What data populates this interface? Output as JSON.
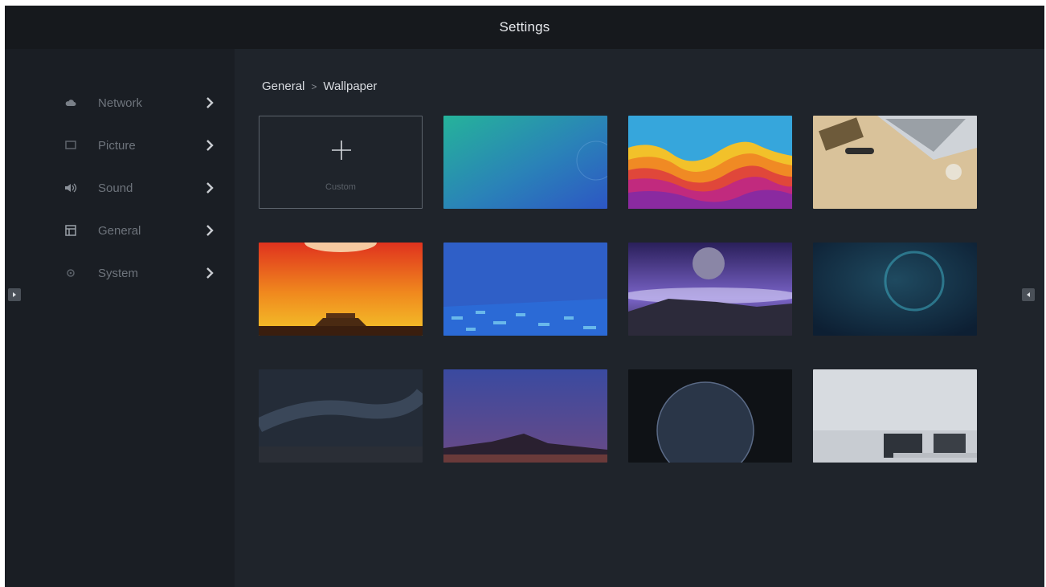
{
  "window": {
    "title": "Settings"
  },
  "sidebar": {
    "items": [
      {
        "label": "Network",
        "icon": "cloud-icon"
      },
      {
        "label": "Picture",
        "icon": "picture-icon"
      },
      {
        "label": "Sound",
        "icon": "speaker-icon"
      },
      {
        "label": "General",
        "icon": "window-icon"
      },
      {
        "label": "System",
        "icon": "gear-icon"
      }
    ]
  },
  "breadcrumb": {
    "parent": "General",
    "separator": ">",
    "current": "Wallpaper"
  },
  "wallpapers": {
    "custom_label": "Custom",
    "items": [
      {
        "name": "teal-blue-gradient"
      },
      {
        "name": "colorful-waves"
      },
      {
        "name": "wooden-desk"
      },
      {
        "name": "sunset-palace"
      },
      {
        "name": "blue-digital"
      },
      {
        "name": "purple-moon-mountain"
      },
      {
        "name": "dark-blue-ring"
      },
      {
        "name": "milky-way"
      },
      {
        "name": "starry-mountain"
      },
      {
        "name": "earth-from-space"
      },
      {
        "name": "office-room"
      }
    ]
  },
  "colors": {
    "background": "#1f242b",
    "sidebar": "#1a1e24",
    "titlebar": "#16191d",
    "text_primary": "#d9dce1",
    "text_muted": "#6e747c"
  }
}
